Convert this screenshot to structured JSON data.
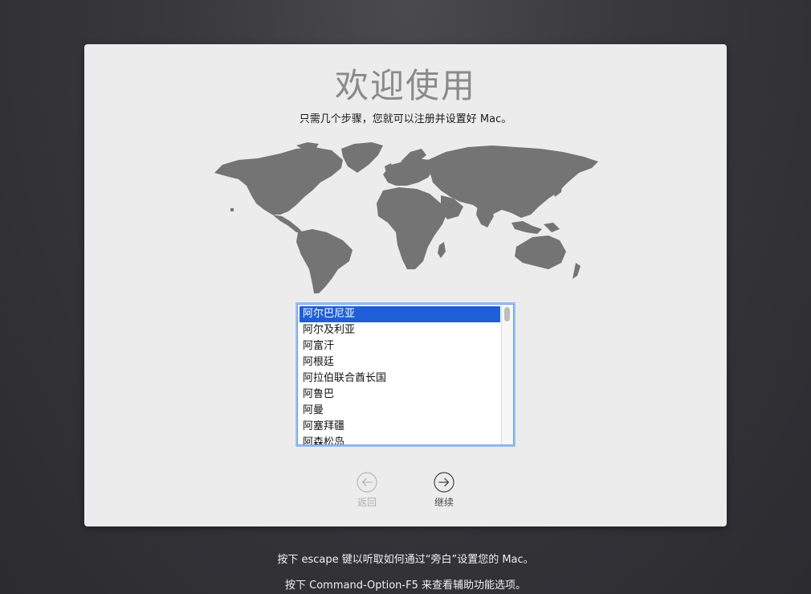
{
  "welcome": {
    "title": "欢迎使用",
    "subtitle": "只需几个步骤，您就可以注册并设置好 Mac。"
  },
  "map": {
    "icon": "world-map",
    "land_color": "#747474"
  },
  "country_list": {
    "items": [
      "阿尔巴尼亚",
      "阿尔及利亚",
      "阿富汗",
      "阿根廷",
      "阿拉伯联合酋长国",
      "阿鲁巴",
      "阿曼",
      "阿塞拜疆",
      "阿森松岛"
    ],
    "selected": "阿尔巴尼亚",
    "selection_color": "#1d5fd7"
  },
  "nav": {
    "back_label": "返回",
    "continue_label": "继续"
  },
  "footer": {
    "line1": "按下 escape 键以听取如何通过“旁白”设置您的 Mac。",
    "line2": "按下 Command-Option-F5 来查看辅助功能选项。"
  }
}
